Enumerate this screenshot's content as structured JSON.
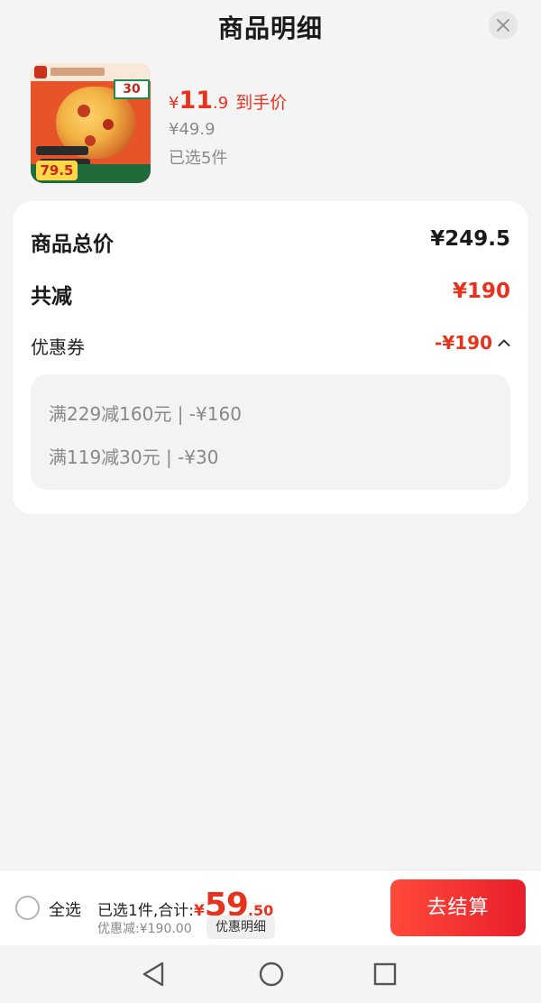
{
  "header": {
    "title": "商品明细"
  },
  "product": {
    "image_badge": "30",
    "image_price": "79.5",
    "price_currency": "¥",
    "price_int": "11",
    "price_dec": ".9",
    "price_tag": "到手价",
    "original_price": "¥49.9",
    "selected_count": "已选5件"
  },
  "summary": {
    "total_label": "商品总价",
    "total_value": "¥249.5",
    "reduce_label": "共减",
    "reduce_value": "¥190",
    "coupon_label": "优惠券",
    "coupon_value": "-¥190",
    "coupons": [
      {
        "text": "满229减160元 | -¥160"
      },
      {
        "text": "满119减30元 | -¥30"
      }
    ]
  },
  "bottom_bar": {
    "select_all_label": "全选",
    "total_prefix": "已选1件,合计:",
    "total_currency": "¥",
    "total_int": "59",
    "total_dec": ".50",
    "discount_text": "优惠减:¥190.00",
    "detail_button": "优惠明细",
    "checkout_button": "去结算"
  },
  "colors": {
    "accent_red": "#e8321d",
    "checkout_gradient_start": "#ff4a3a",
    "checkout_gradient_end": "#e81f2c",
    "background": "#f4f4f4",
    "card": "#ffffff"
  },
  "icons": {
    "close": "close-icon",
    "chevron": "chevron-up-icon",
    "nav_back": "back-triangle-icon",
    "nav_home": "home-circle-icon",
    "nav_recent": "recent-square-icon"
  }
}
